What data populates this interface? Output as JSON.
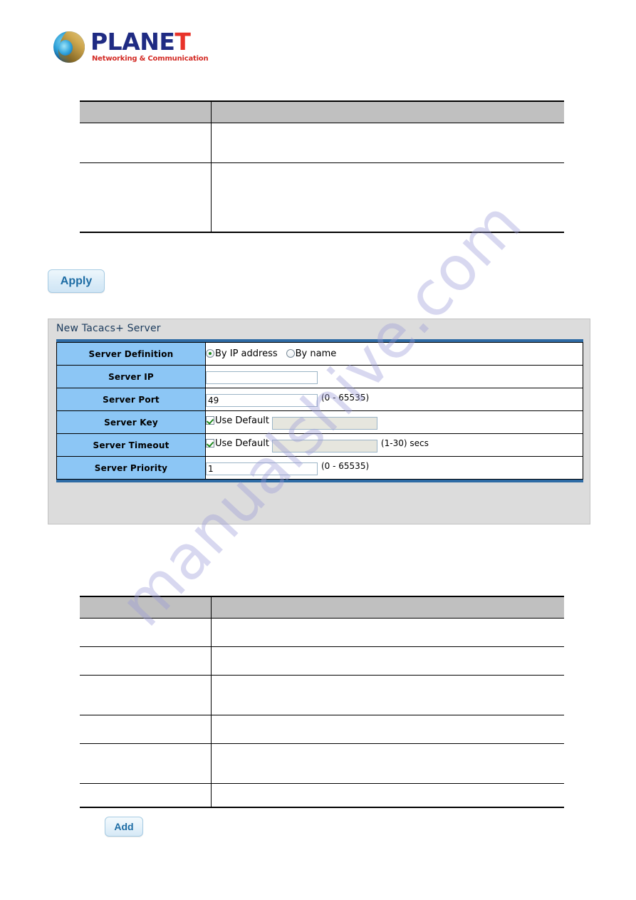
{
  "brand": {
    "logo_icon": "planet-globe-icon",
    "name_main": "PLANE",
    "name_accent": "T",
    "tagline": "Networking & Communication"
  },
  "watermark": {
    "text": "manualshive.com"
  },
  "top_table": {
    "header": [
      "",
      ""
    ],
    "rows": [
      [
        "",
        ""
      ],
      [
        "",
        ""
      ]
    ]
  },
  "bottom_table": {
    "header": [
      "",
      ""
    ],
    "rows": [
      [
        "",
        ""
      ],
      [
        "",
        ""
      ],
      [
        "",
        ""
      ],
      [
        "",
        ""
      ],
      [
        "",
        ""
      ],
      [
        "",
        ""
      ]
    ]
  },
  "apply": {
    "label": "Apply"
  },
  "panel": {
    "title": "New Tacacs+ Server",
    "add_label": "Add",
    "rows": {
      "server_definition": {
        "label": "Server Definition",
        "option_ip": "By IP address",
        "option_name": "By name",
        "selected": "By IP address"
      },
      "server_ip": {
        "label": "Server IP",
        "value": "",
        "placeholder": ""
      },
      "server_port": {
        "label": "Server Port",
        "value": "49",
        "hint": "(0 - 65535)"
      },
      "server_key": {
        "label": "Server Key",
        "use_default_label": "Use Default",
        "use_default_checked": "true",
        "value": "",
        "hint": ""
      },
      "server_timeout": {
        "label": "Server Timeout",
        "use_default_label": "Use Default",
        "use_default_checked": "true",
        "value": "",
        "hint": "(1-30) secs"
      },
      "server_priority": {
        "label": "Server Priority",
        "value": "1",
        "hint": "(0 - 65535)"
      }
    }
  },
  "colors": {
    "panel_bg": "#dcdcdc",
    "label_blue": "#8cc6f5",
    "frame_blue": "#2e6ba5",
    "button_text": "#1d6ca4",
    "table_header_grey": "#c0c0c0",
    "brand_navy": "#1f2b83",
    "brand_red": "#e8332a",
    "radio_dot_green": "#1f8a1f"
  }
}
